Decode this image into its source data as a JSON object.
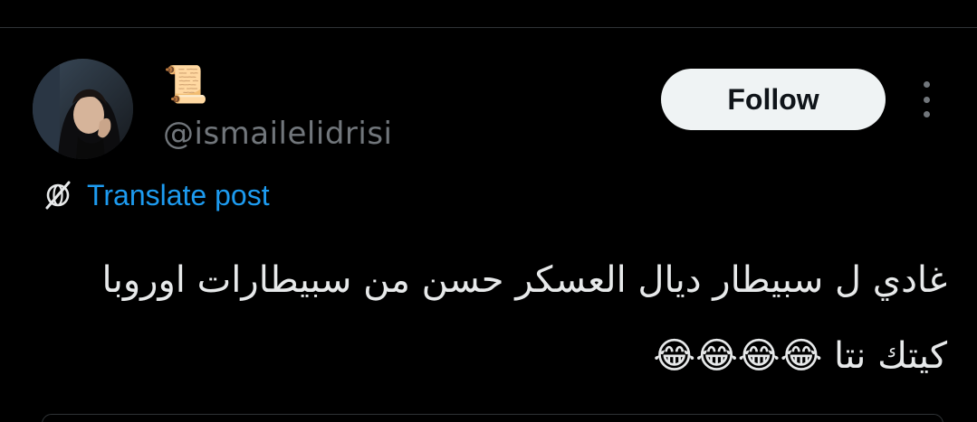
{
  "author": {
    "display_name": "📜",
    "handle": "@ismailelidrisi"
  },
  "actions": {
    "follow_label": "Follow",
    "more_icon": "more-vertical-icon"
  },
  "translate": {
    "label": "Translate post",
    "icon": "translate-globe-icon"
  },
  "post": {
    "text": "غادي ل سبيطار ديال العسكر حسن من سبيطارات اوروبا\nكيتك نتا 😂😂😂😂"
  },
  "colors": {
    "background": "#000000",
    "link": "#1d9bf0",
    "secondary_text": "#71767b",
    "button_bg": "#eff3f4",
    "divider": "#2f3336"
  }
}
